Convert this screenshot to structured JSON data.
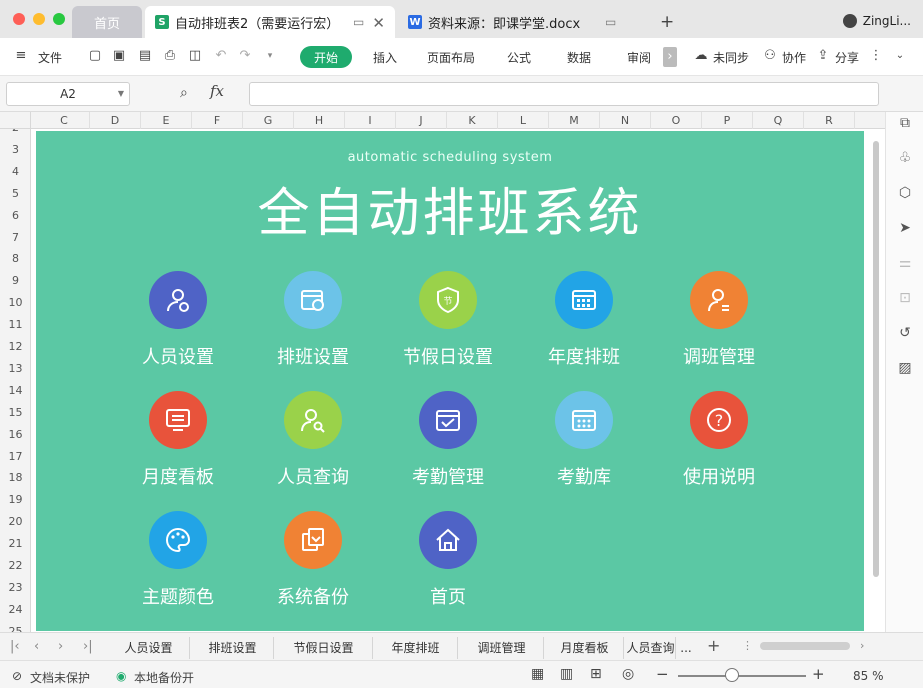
{
  "window": {
    "tabs": [
      {
        "label": "首页"
      },
      {
        "label": "自动排班表2（需要运行宏）"
      },
      {
        "label": "资料来源：即课学堂.docx"
      }
    ],
    "user": "ZingLi..."
  },
  "menu": {
    "file": "文件",
    "items": [
      "开始",
      "插入",
      "页面布局",
      "公式",
      "数据",
      "审阅"
    ],
    "right": [
      "未同步",
      "协作",
      "分享"
    ]
  },
  "formula_bar": {
    "cell_ref": "A2",
    "fx": "fx",
    "value": ""
  },
  "columns": [
    "C",
    "D",
    "E",
    "F",
    "G",
    "H",
    "I",
    "J",
    "K",
    "L",
    "M",
    "N",
    "O",
    "P",
    "Q",
    "R"
  ],
  "rows": [
    "2",
    "3",
    "4",
    "5",
    "6",
    "7",
    "8",
    "9",
    "10",
    "11",
    "12",
    "13",
    "14",
    "15",
    "16",
    "17",
    "18",
    "19",
    "20",
    "21",
    "22",
    "23",
    "24",
    "25"
  ],
  "dashboard": {
    "subtitle": "automatic scheduling system",
    "title": "全自动排班系统",
    "items": [
      {
        "label": "人员设置",
        "icon": "user-gear-icon",
        "color": "#4f63c6"
      },
      {
        "label": "排班设置",
        "icon": "calendar-clock-icon",
        "color": "#6cc3e8"
      },
      {
        "label": "节假日设置",
        "icon": "holiday-shield-icon",
        "color": "#9ad24a"
      },
      {
        "label": "年度排班",
        "icon": "calendar-grid-icon",
        "color": "#22a4e6"
      },
      {
        "label": "调班管理",
        "icon": "user-swap-icon",
        "color": "#f08234"
      },
      {
        "label": "月度看板",
        "icon": "monitor-board-icon",
        "color": "#e8533b"
      },
      {
        "label": "人员查询",
        "icon": "user-search-icon",
        "color": "#9ad24a"
      },
      {
        "label": "考勤管理",
        "icon": "calendar-check-icon",
        "color": "#4f63c6"
      },
      {
        "label": "考勤库",
        "icon": "calendar-hearts-icon",
        "color": "#6cc3e8"
      },
      {
        "label": "使用说明",
        "icon": "help-icon",
        "color": "#e8533b"
      },
      {
        "label": "主题颜色",
        "icon": "palette-icon",
        "color": "#22a4e6"
      },
      {
        "label": "系统备份",
        "icon": "backup-icon",
        "color": "#f08234"
      },
      {
        "label": "首页",
        "icon": "home-icon",
        "color": "#4f63c6"
      }
    ]
  },
  "sheet_tabs": [
    "人员设置",
    "排班设置",
    "节假日设置",
    "年度排班",
    "调班管理",
    "月度看板",
    "人员查询"
  ],
  "sheet_tabs_more": "...",
  "status": {
    "protect": "文档未保护",
    "backup": "本地备份开",
    "zoom": "85 %"
  }
}
